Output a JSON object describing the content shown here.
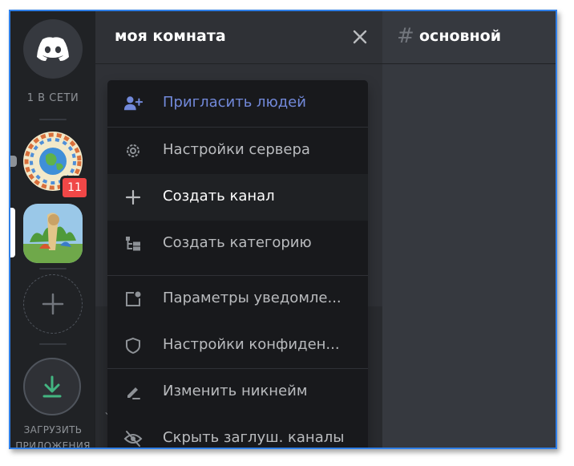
{
  "rail": {
    "online_label": "1 В СЕТИ",
    "server_badge": "11",
    "download_label": "ЗАГРУЗИТЬ ПРИЛОЖЕНИЯ"
  },
  "server": {
    "name": "моя комната"
  },
  "channel": {
    "hash": "#",
    "name": "основной"
  },
  "menu": {
    "items": [
      {
        "label": "Пригласить людей",
        "icon": "invite-people-icon"
      },
      {
        "label": "Настройки сервера",
        "icon": "gear-icon"
      },
      {
        "label": "Создать канал",
        "icon": "plus-icon"
      },
      {
        "label": "Создать категорию",
        "icon": "category-icon"
      },
      {
        "label": "Параметры уведомле...",
        "icon": "notification-icon"
      },
      {
        "label": "Настройки конфиден...",
        "icon": "shield-icon"
      },
      {
        "label": "Изменить никнейм",
        "icon": "pencil-icon"
      },
      {
        "label": "Скрыть заглуш. каналы",
        "icon": "eye-off-icon"
      }
    ]
  },
  "colors": {
    "accent": "#7289da",
    "badge": "#f04747",
    "download": "#43b581"
  }
}
